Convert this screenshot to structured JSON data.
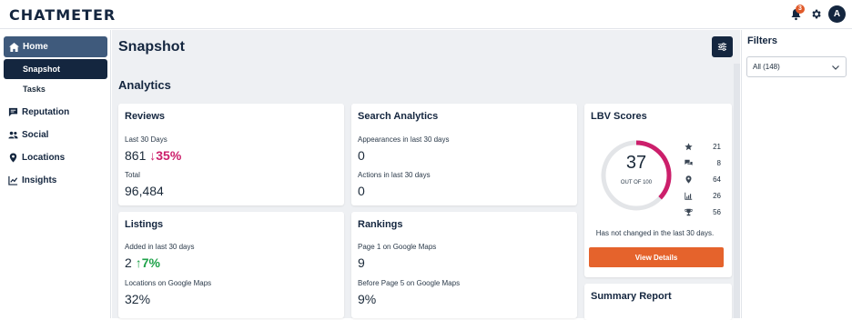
{
  "header": {
    "logo": "CHATMETER",
    "notifications_count": "3",
    "avatar_initial": "A"
  },
  "sidebar": {
    "home_label": "Home",
    "active_sub_label": "Snapshot",
    "sub_label": "Tasks",
    "items": [
      {
        "label": "Reputation",
        "icon": "chat-icon"
      },
      {
        "label": "Social",
        "icon": "people-icon"
      },
      {
        "label": "Locations",
        "icon": "pin-icon"
      },
      {
        "label": "Insights",
        "icon": "insights-icon"
      }
    ]
  },
  "page": {
    "title": "Snapshot",
    "section_title": "Analytics"
  },
  "reviews": {
    "title": "Reviews",
    "label1": "Last 30 Days",
    "value1": "861",
    "trend": "↓35%",
    "label2": "Total",
    "value2": "96,484"
  },
  "search": {
    "title": "Search Analytics",
    "label1": "Appearances in last 30 days",
    "value1": "0",
    "label2": "Actions in last 30 days",
    "value2": "0"
  },
  "listings": {
    "title": "Listings",
    "label1": "Added in last 30 days",
    "value1": "2",
    "trend": "↑7%",
    "label2": "Locations on Google Maps",
    "value2": "32%"
  },
  "rankings": {
    "title": "Rankings",
    "label1": "Page 1 on Google Maps",
    "value1": "9",
    "label2": "Before Page 5 on Google Maps",
    "value2": "9%"
  },
  "lbv": {
    "title": "LBV Scores",
    "score": "37",
    "score_fraction": 0.37,
    "out_of": "OUT OF 100",
    "stats": [
      {
        "icon": "star-icon",
        "value": "21"
      },
      {
        "icon": "chat-bubbles-icon",
        "value": "8"
      },
      {
        "icon": "pin-icon",
        "value": "64"
      },
      {
        "icon": "chart-icon",
        "value": "26"
      },
      {
        "icon": "trophy-icon",
        "value": "56"
      }
    ],
    "note": "Has not changed in the last 30 days.",
    "button": "View Details"
  },
  "summary": {
    "title": "Summary Report"
  },
  "filters": {
    "title": "Filters",
    "selected": "All (148)"
  },
  "colors": {
    "navy": "#14263f",
    "orange": "#e5632c",
    "magenta": "#cc1f6b",
    "green": "#1fa24a"
  }
}
